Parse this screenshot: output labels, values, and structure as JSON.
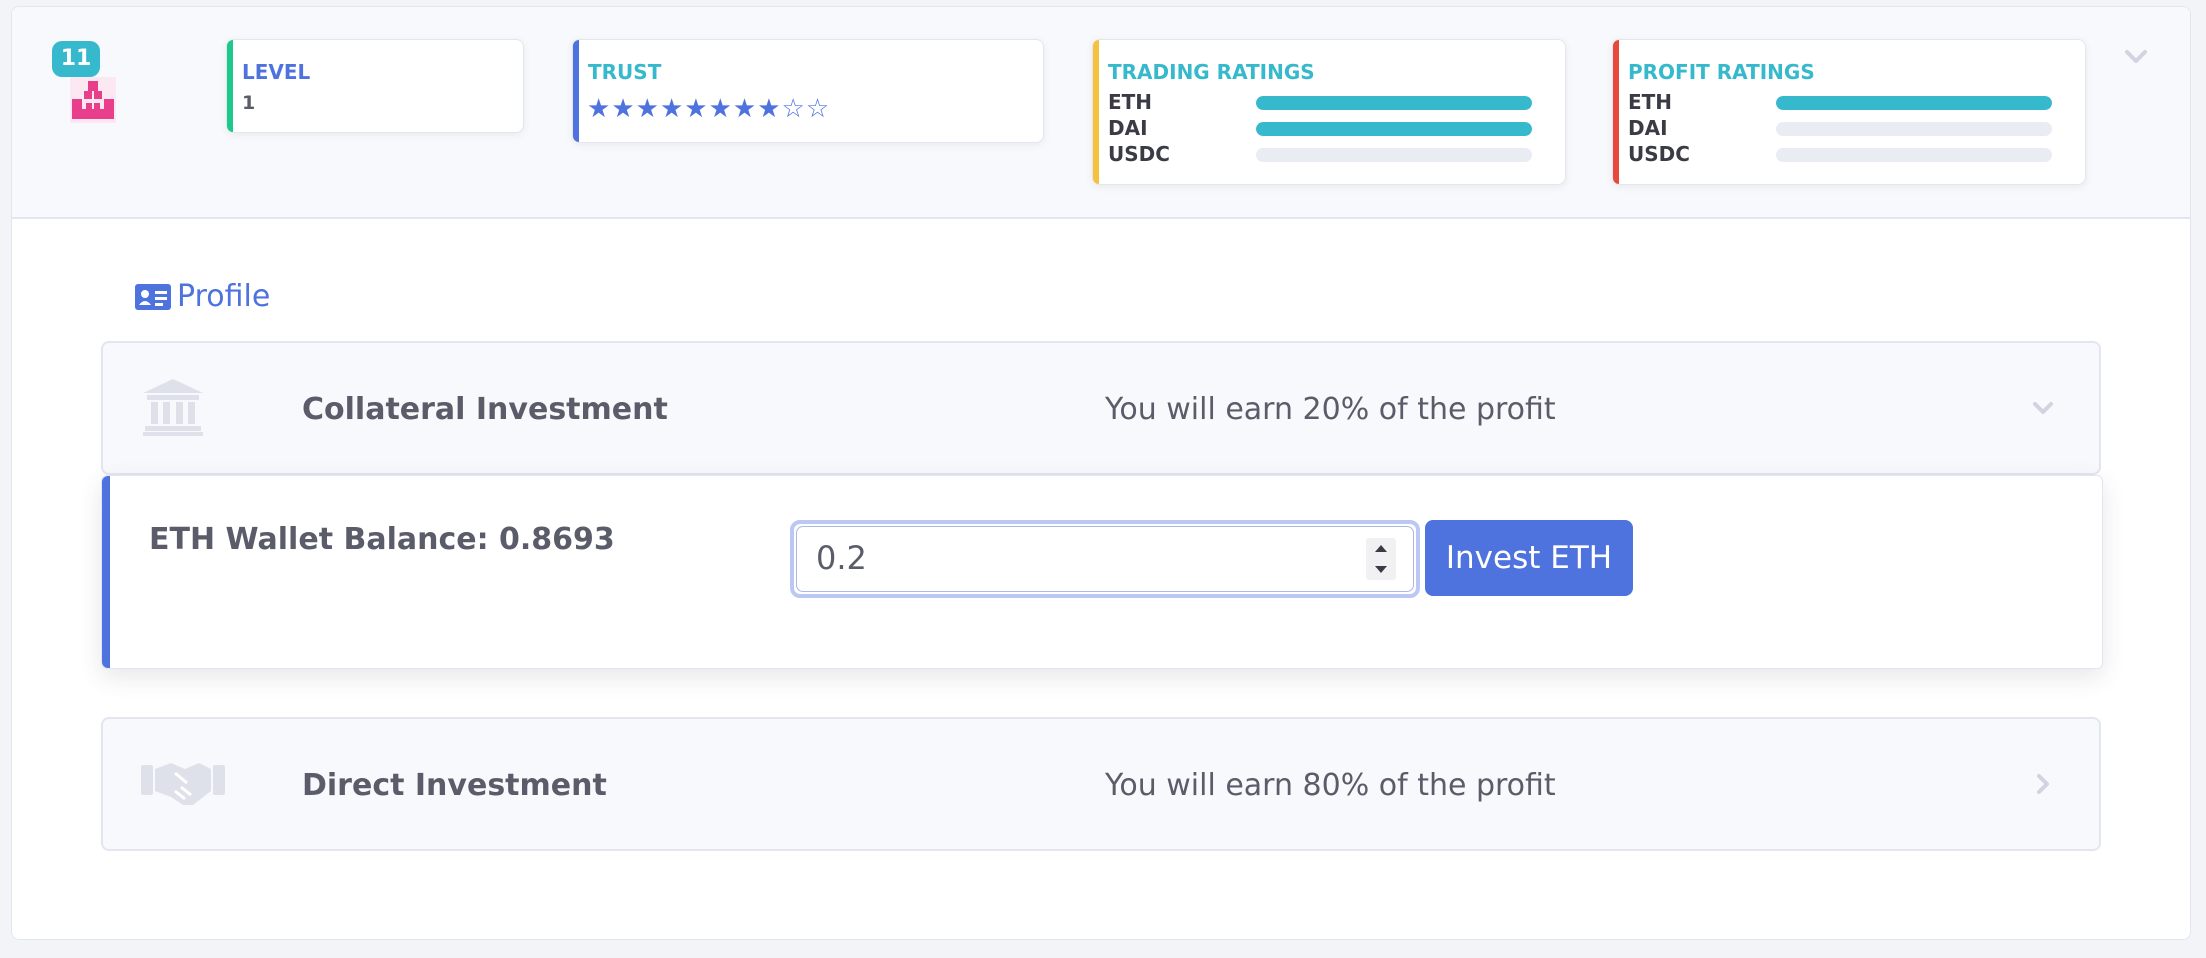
{
  "header": {
    "level_badge": "11",
    "level": {
      "title": "LEVEL",
      "value": "1",
      "accent": "#1cc88a",
      "title_color": "#4e73df"
    },
    "trust": {
      "title": "TRUST",
      "stars_filled": 8,
      "stars_total": 10,
      "accent": "#4e73df",
      "title_color": "#36b9cc"
    },
    "trading_ratings": {
      "title": "TRADING RATINGS",
      "accent": "#f6c23e",
      "title_color": "#36b9cc",
      "rows": [
        {
          "label": "ETH",
          "fill": 1.0
        },
        {
          "label": "DAI",
          "fill": 1.0
        },
        {
          "label": "USDC",
          "fill": 0.0
        }
      ]
    },
    "profit_ratings": {
      "title": "PROFIT RATINGS",
      "accent": "#e74a3b",
      "title_color": "#36b9cc",
      "rows": [
        {
          "label": "ETH",
          "fill": 1.0
        },
        {
          "label": "DAI",
          "fill": 0.0
        },
        {
          "label": "USDC",
          "fill": 0.0
        }
      ]
    }
  },
  "profile_link": "Profile",
  "collateral": {
    "title": "Collateral Investment",
    "description": "You will earn 20% of the profit",
    "balance_label": "ETH Wallet Balance: 0.8693",
    "amount_value": "0.2",
    "invest_label": "Invest ETH"
  },
  "direct": {
    "title": "Direct Investment",
    "description": "You will earn 80% of the profit"
  },
  "colors": {
    "primary": "#4e73df",
    "info": "#36b9cc",
    "success": "#1cc88a",
    "warning": "#f6c23e",
    "danger": "#e74a3b",
    "avatar": "#e83e8c"
  }
}
